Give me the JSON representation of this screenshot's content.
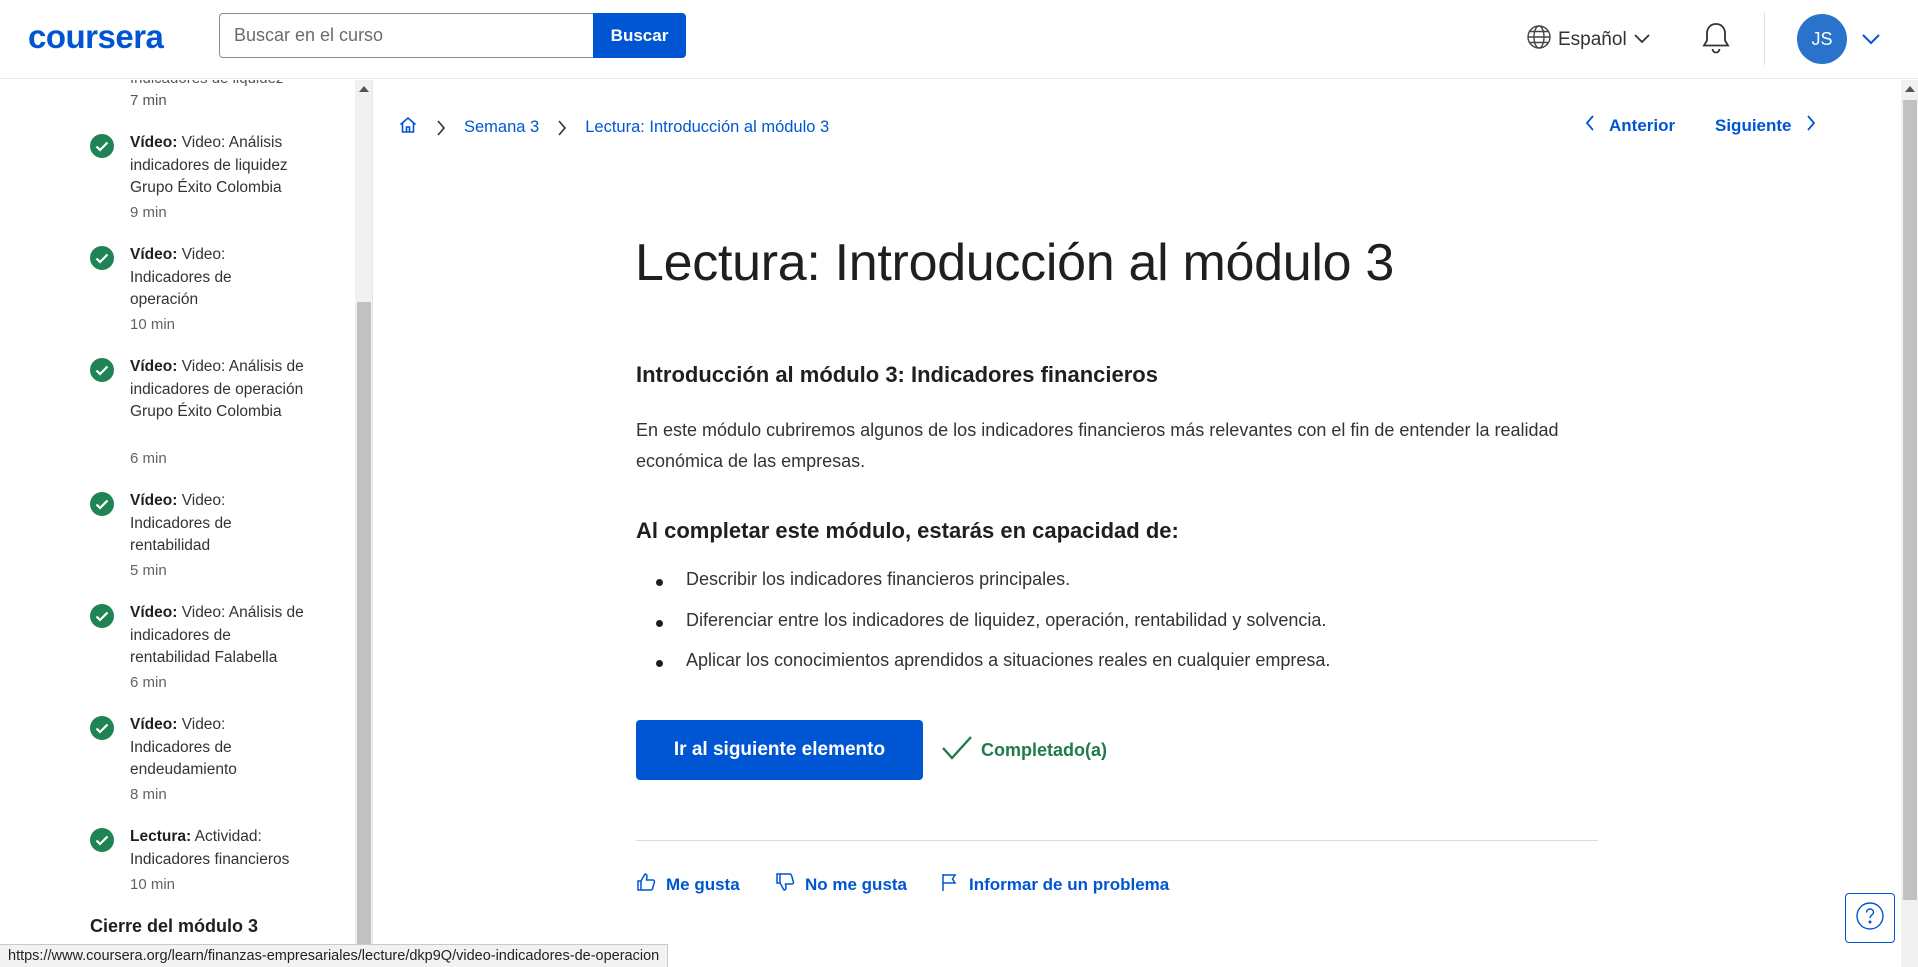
{
  "header": {
    "logo": "coursera",
    "search_placeholder": "Buscar en el curso",
    "search_button": "Buscar",
    "language": "Español",
    "avatar_initials": "JS"
  },
  "sidebar": {
    "top_partial_text": "Indicadores de liquidez",
    "top_partial_duration": "7 min",
    "items": [
      {
        "type": "Vídeo:",
        "title": "Video: Análisis indicadores de liquidez Grupo Éxito Colombia",
        "duration": "9 min",
        "status": "completed"
      },
      {
        "type": "Vídeo:",
        "title": "Video: Indicadores de operación",
        "duration": "10 min",
        "status": "completed"
      },
      {
        "type": "Vídeo:",
        "title": "Video: Análisis de indicadores de operación Grupo Éxito Colombia",
        "duration": "6 min",
        "status": "completed"
      },
      {
        "type": "Vídeo:",
        "title": "Video: Indicadores de rentabilidad",
        "duration": "5 min",
        "status": "completed"
      },
      {
        "type": "Vídeo:",
        "title": "Video: Análisis de indicadores de rentabilidad Falabella",
        "duration": "6 min",
        "status": "completed"
      },
      {
        "type": "Vídeo:",
        "title": "Video: Indicadores de endeudamiento",
        "duration": "8 min",
        "status": "completed"
      },
      {
        "type": "Lectura:",
        "title": "Actividad: Indicadores financieros",
        "duration": "10 min",
        "status": "completed"
      }
    ],
    "section_heading": "Cierre del módulo 3"
  },
  "breadcrumb": {
    "home_icon": "home-icon",
    "week": "Semana 3",
    "current": "Lectura: Introducción al módulo 3"
  },
  "nav": {
    "prev": "Anterior",
    "next": "Siguiente"
  },
  "content": {
    "title": "Lectura: Introducción al módulo 3",
    "subheading": "Introducción al módulo 3: Indicadores financieros",
    "paragraph": "En este módulo cubriremos algunos de los indicadores financieros más relevantes con el fin de entender la realidad económica de las empresas.",
    "objectives_heading": "Al completar este módulo, estarás en capacidad de:",
    "objectives": [
      "Describir los indicadores financieros principales.",
      "Diferenciar entre los indicadores de liquidez, operación, rentabilidad y solvencia.",
      "Aplicar los conocimientos aprendidos a situaciones reales en cualquier empresa."
    ],
    "next_button": "Ir al siguiente elemento",
    "completed_label": "Completado(a)"
  },
  "feedback": {
    "like": "Me gusta",
    "dislike": "No me gusta",
    "report": "Informar de un problema"
  },
  "status_bar_url": "https://www.coursera.org/learn/finanzas-empresariales/lecture/dkp9Q/video-indicadores-de-operacion",
  "colors": {
    "brand_blue": "#0056d2",
    "completed_green": "#1f8354",
    "text_dark": "#1f1f1f"
  }
}
